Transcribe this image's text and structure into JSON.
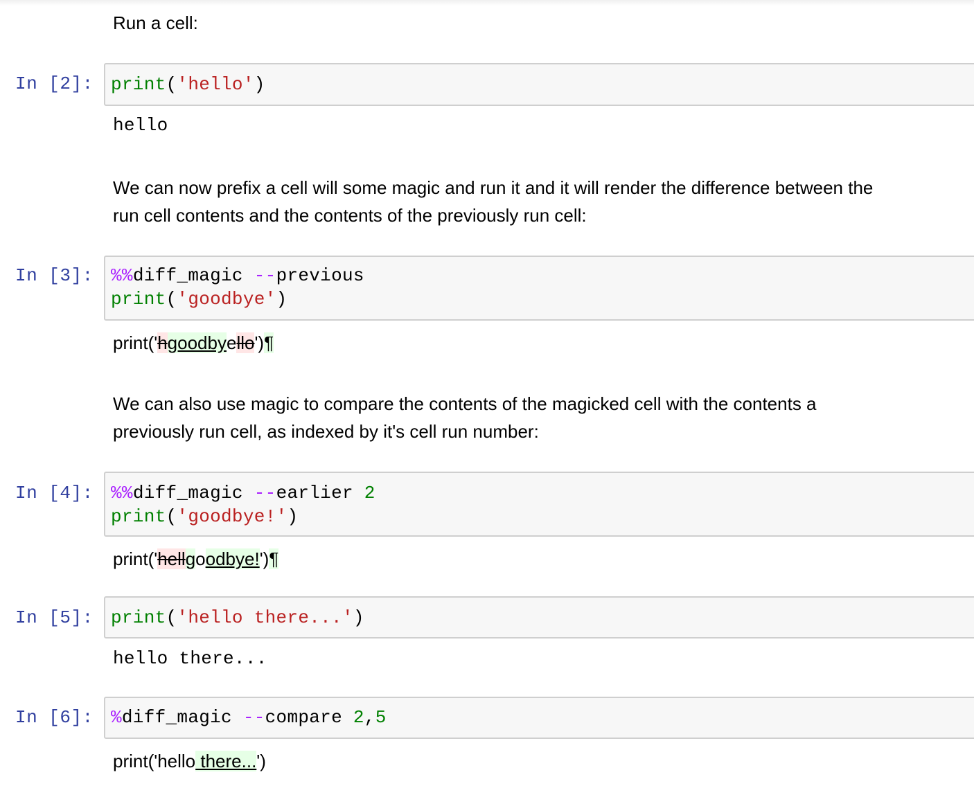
{
  "md1": "Run a cell:",
  "md2_line1": "We can now prefix a cell will some magic and run it and it will render the difference between the",
  "md2_line2": "run cell contents and the contents of the previously run cell:",
  "md3_line1": "We can also use magic to compare the contents of the magicked cell with the contents a",
  "md3_line2": "previously run cell, as indexed by it's cell run number:",
  "cells": [
    {
      "prompt": "In [2]:",
      "output": "hello"
    },
    {
      "prompt": "In [3]:"
    },
    {
      "prompt": "In [4]:"
    },
    {
      "prompt": "In [5]:",
      "output": "hello there..."
    },
    {
      "prompt": "In [6]:"
    }
  ],
  "code": {
    "c2": {
      "fn": "print",
      "open": "(",
      "str": "'hello'",
      "close": ")"
    },
    "c3": {
      "magic": "%%",
      "name": "diff_magic ",
      "dashes": "--",
      "opt": "previous",
      "fn": "print",
      "open": "(",
      "str": "'goodbye'",
      "close": ")"
    },
    "c4": {
      "magic": "%%",
      "name": "diff_magic ",
      "dashes": "--",
      "opt": "earlier ",
      "num": "2",
      "fn": "print",
      "open": "(",
      "str": "'goodbye!'",
      "close": ")"
    },
    "c5": {
      "fn": "print",
      "open": "(",
      "str": "'hello there...'",
      "close": ")"
    },
    "c6": {
      "magic": "%",
      "name": "diff_magic ",
      "dashes": "--",
      "opt": "compare ",
      "n1": "2",
      "comma": ",",
      "n2": "5"
    }
  },
  "diffs": {
    "d3": {
      "pre": "print('",
      "del1": "h",
      "ins1": "goodby",
      "eq1": "e",
      "del2": "llo",
      "post": "')",
      "pil": "¶"
    },
    "d4": {
      "pre": "print('",
      "del1": "hell",
      "ins1": "g",
      "eq1": "o",
      "ins2": "odbye!",
      "post": "')",
      "pil": "¶"
    },
    "d6": {
      "pre": "print('hello",
      "ins1": " there...",
      "post": "')"
    }
  },
  "colors": {
    "prompt": "#303f9f",
    "keyword": "#008000",
    "string": "#ba2121",
    "magic": "#aa22ff",
    "diff_delete_bg": "#ffe6e6",
    "diff_insert_bg": "#e6ffe6"
  }
}
